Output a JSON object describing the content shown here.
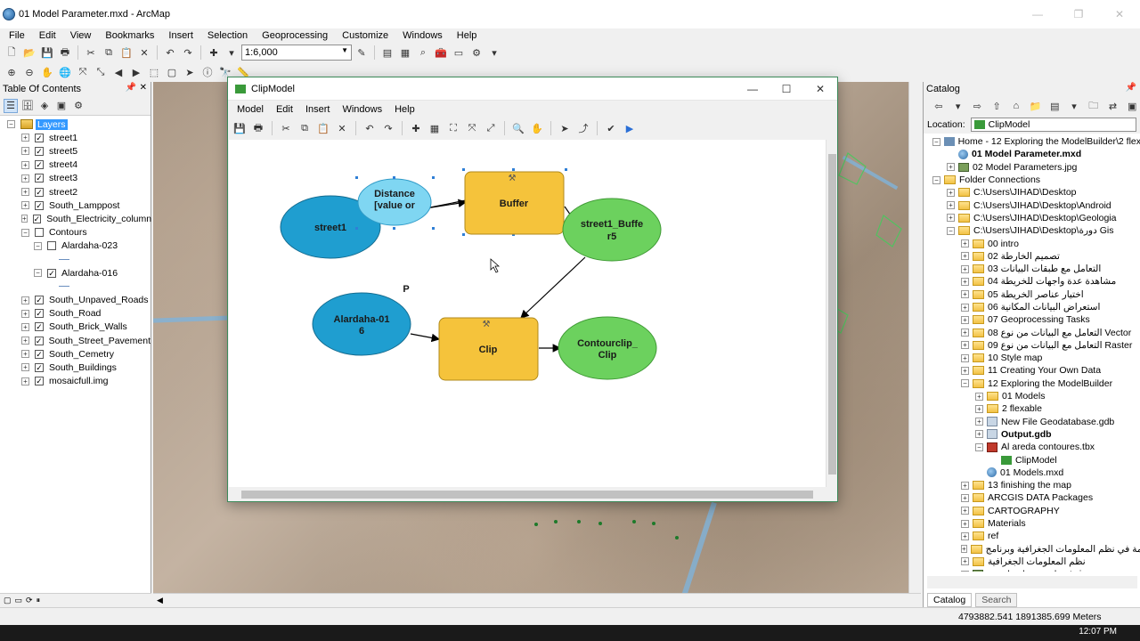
{
  "window": {
    "title": "01 Model Parameter.mxd - ArcMap"
  },
  "menu": [
    "File",
    "Edit",
    "View",
    "Bookmarks",
    "Insert",
    "Selection",
    "Geoprocessing",
    "Customize",
    "Windows",
    "Help"
  ],
  "toolbar": {
    "scale": "1:6,000"
  },
  "toc": {
    "title": "Table Of Contents",
    "root": "Layers",
    "items": [
      {
        "label": "street1",
        "checked": true,
        "indent": 1
      },
      {
        "label": "street5",
        "checked": true,
        "indent": 1
      },
      {
        "label": "street4",
        "checked": true,
        "indent": 1
      },
      {
        "label": "street3",
        "checked": true,
        "indent": 1
      },
      {
        "label": "street2",
        "checked": true,
        "indent": 1
      },
      {
        "label": "South_Lamppost",
        "checked": true,
        "indent": 1
      },
      {
        "label": "South_Electricity_column",
        "checked": true,
        "indent": 1
      },
      {
        "label": "Contours",
        "checked": false,
        "indent": 1,
        "expanded": true
      },
      {
        "label": "Alardaha-023",
        "checked": false,
        "indent": 2,
        "expanded": true
      },
      {
        "label": "",
        "symbol": true
      },
      {
        "label": "Alardaha-016",
        "checked": true,
        "indent": 2,
        "expanded": true
      },
      {
        "label": "",
        "symbol": true
      },
      {
        "label": "South_Unpaved_Roads",
        "checked": true,
        "indent": 1
      },
      {
        "label": "South_Road",
        "checked": true,
        "indent": 1
      },
      {
        "label": "South_Brick_Walls",
        "checked": true,
        "indent": 1
      },
      {
        "label": "South_Street_Pavement",
        "checked": true,
        "indent": 1
      },
      {
        "label": "South_Cemetry",
        "checked": true,
        "indent": 1
      },
      {
        "label": "South_Buildings",
        "checked": true,
        "indent": 1
      },
      {
        "label": "mosaicfull.img",
        "checked": true,
        "indent": 1
      }
    ]
  },
  "modelbuilder": {
    "title": "ClipModel",
    "menu": [
      "Model",
      "Edit",
      "Insert",
      "Windows",
      "Help"
    ],
    "nodes": {
      "street1": "street1",
      "distance_l1": "Distance",
      "distance_l2": "[value or",
      "buffer": "Buffer",
      "buffer_out_l1": "street1_Buffe",
      "buffer_out_l2": "r5",
      "p_label": "P",
      "alardaha_l1": "Alardaha-01",
      "alardaha_l2": "6",
      "clip": "Clip",
      "clip_out_l1": "Contourclip_",
      "clip_out_l2": "Clip"
    },
    "colors": {
      "input": "#1f9ed0",
      "tool": "#f5c33b",
      "output": "#6cd15e",
      "selected": "#7fd6f2"
    }
  },
  "catalog": {
    "title": "Catalog",
    "location_label": "Location:",
    "location_value": "ClipModel",
    "tree": [
      {
        "label": "Home - 12 Exploring the ModelBuilder\\2 flex",
        "icon": "home",
        "level": 0,
        "exp": "-"
      },
      {
        "label": "01 Model Parameter.mxd",
        "icon": "mxd",
        "level": 1,
        "bold": true
      },
      {
        "label": "02 Model Parameters.jpg",
        "icon": "jpg",
        "level": 1,
        "exp": "+"
      },
      {
        "label": "Folder Connections",
        "icon": "conn",
        "level": 0,
        "exp": "-"
      },
      {
        "label": "C:\\Users\\JIHAD\\Desktop",
        "icon": "folder",
        "level": 1,
        "exp": "+"
      },
      {
        "label": "C:\\Users\\JIHAD\\Desktop\\Android",
        "icon": "folder",
        "level": 1,
        "exp": "+"
      },
      {
        "label": "C:\\Users\\JIHAD\\Desktop\\Geologia",
        "icon": "folder",
        "level": 1,
        "exp": "+"
      },
      {
        "label": "C:\\Users\\JIHAD\\Desktop\\دورة Gis",
        "icon": "folder",
        "level": 1,
        "exp": "-"
      },
      {
        "label": "00 intro",
        "icon": "folder",
        "level": 2,
        "exp": "+"
      },
      {
        "label": "02 تصميم الخارطة",
        "icon": "folder",
        "level": 2,
        "exp": "+"
      },
      {
        "label": "03 التعامل مع طبقات البيانات",
        "icon": "folder",
        "level": 2,
        "exp": "+"
      },
      {
        "label": "04 مشاهدة عدة واجهات للخريطة",
        "icon": "folder",
        "level": 2,
        "exp": "+"
      },
      {
        "label": "05 اختيار عناصر الخريطة",
        "icon": "folder",
        "level": 2,
        "exp": "+"
      },
      {
        "label": "06 استعراض البيانات المكانية",
        "icon": "folder",
        "level": 2,
        "exp": "+"
      },
      {
        "label": "07 Geoprocessing Tasks",
        "icon": "folder",
        "level": 2,
        "exp": "+"
      },
      {
        "label": "08 التعامل مع البيانات من نوع Vector",
        "icon": "folder",
        "level": 2,
        "exp": "+"
      },
      {
        "label": "09 التعامل مع البيانات من نوع Raster",
        "icon": "folder",
        "level": 2,
        "exp": "+"
      },
      {
        "label": "10 Style map",
        "icon": "folder",
        "level": 2,
        "exp": "+"
      },
      {
        "label": "11 Creating Your Own Data",
        "icon": "folder",
        "level": 2,
        "exp": "+"
      },
      {
        "label": "12 Exploring the ModelBuilder",
        "icon": "folder",
        "level": 2,
        "exp": "-"
      },
      {
        "label": "01 Models",
        "icon": "folder",
        "level": 3,
        "exp": "+"
      },
      {
        "label": "2 flexable",
        "icon": "folder",
        "level": 3,
        "exp": "+"
      },
      {
        "label": "New File Geodatabase.gdb",
        "icon": "gdb",
        "level": 3,
        "exp": "+"
      },
      {
        "label": "Output.gdb",
        "icon": "gdb",
        "level": 3,
        "exp": "+",
        "bold": true
      },
      {
        "label": "Al areda contoures.tbx",
        "icon": "tbx",
        "level": 3,
        "exp": "-"
      },
      {
        "label": "ClipModel",
        "icon": "model",
        "level": 4
      },
      {
        "label": "01 Models.mxd",
        "icon": "mxd",
        "level": 3
      },
      {
        "label": "13 finishing the map",
        "icon": "folder",
        "level": 2,
        "exp": "+"
      },
      {
        "label": "ARCGIS DATA Packages",
        "icon": "folder",
        "level": 2,
        "exp": "+"
      },
      {
        "label": "CARTOGRAPHY",
        "icon": "folder",
        "level": 2,
        "exp": "+"
      },
      {
        "label": "Materials",
        "icon": "folder",
        "level": 2,
        "exp": "+"
      },
      {
        "label": "ref",
        "icon": "folder",
        "level": 2,
        "exp": "+"
      },
      {
        "label": "مة في نظم المعلومات الجغرافية وبرنامج",
        "icon": "folder",
        "level": 2,
        "exp": "+"
      },
      {
        "label": "نظم المعلومات الجغرافية",
        "icon": "folder",
        "level": 2,
        "exp": "+"
      },
      {
        "label": "map background pptx.jpg",
        "icon": "jpg",
        "level": 2,
        "exp": "+"
      }
    ],
    "tabs": [
      "Catalog",
      "Search"
    ]
  },
  "status": {
    "coords": "4793882.541  1891385.699 Meters",
    "clock": "12:07 PM"
  }
}
